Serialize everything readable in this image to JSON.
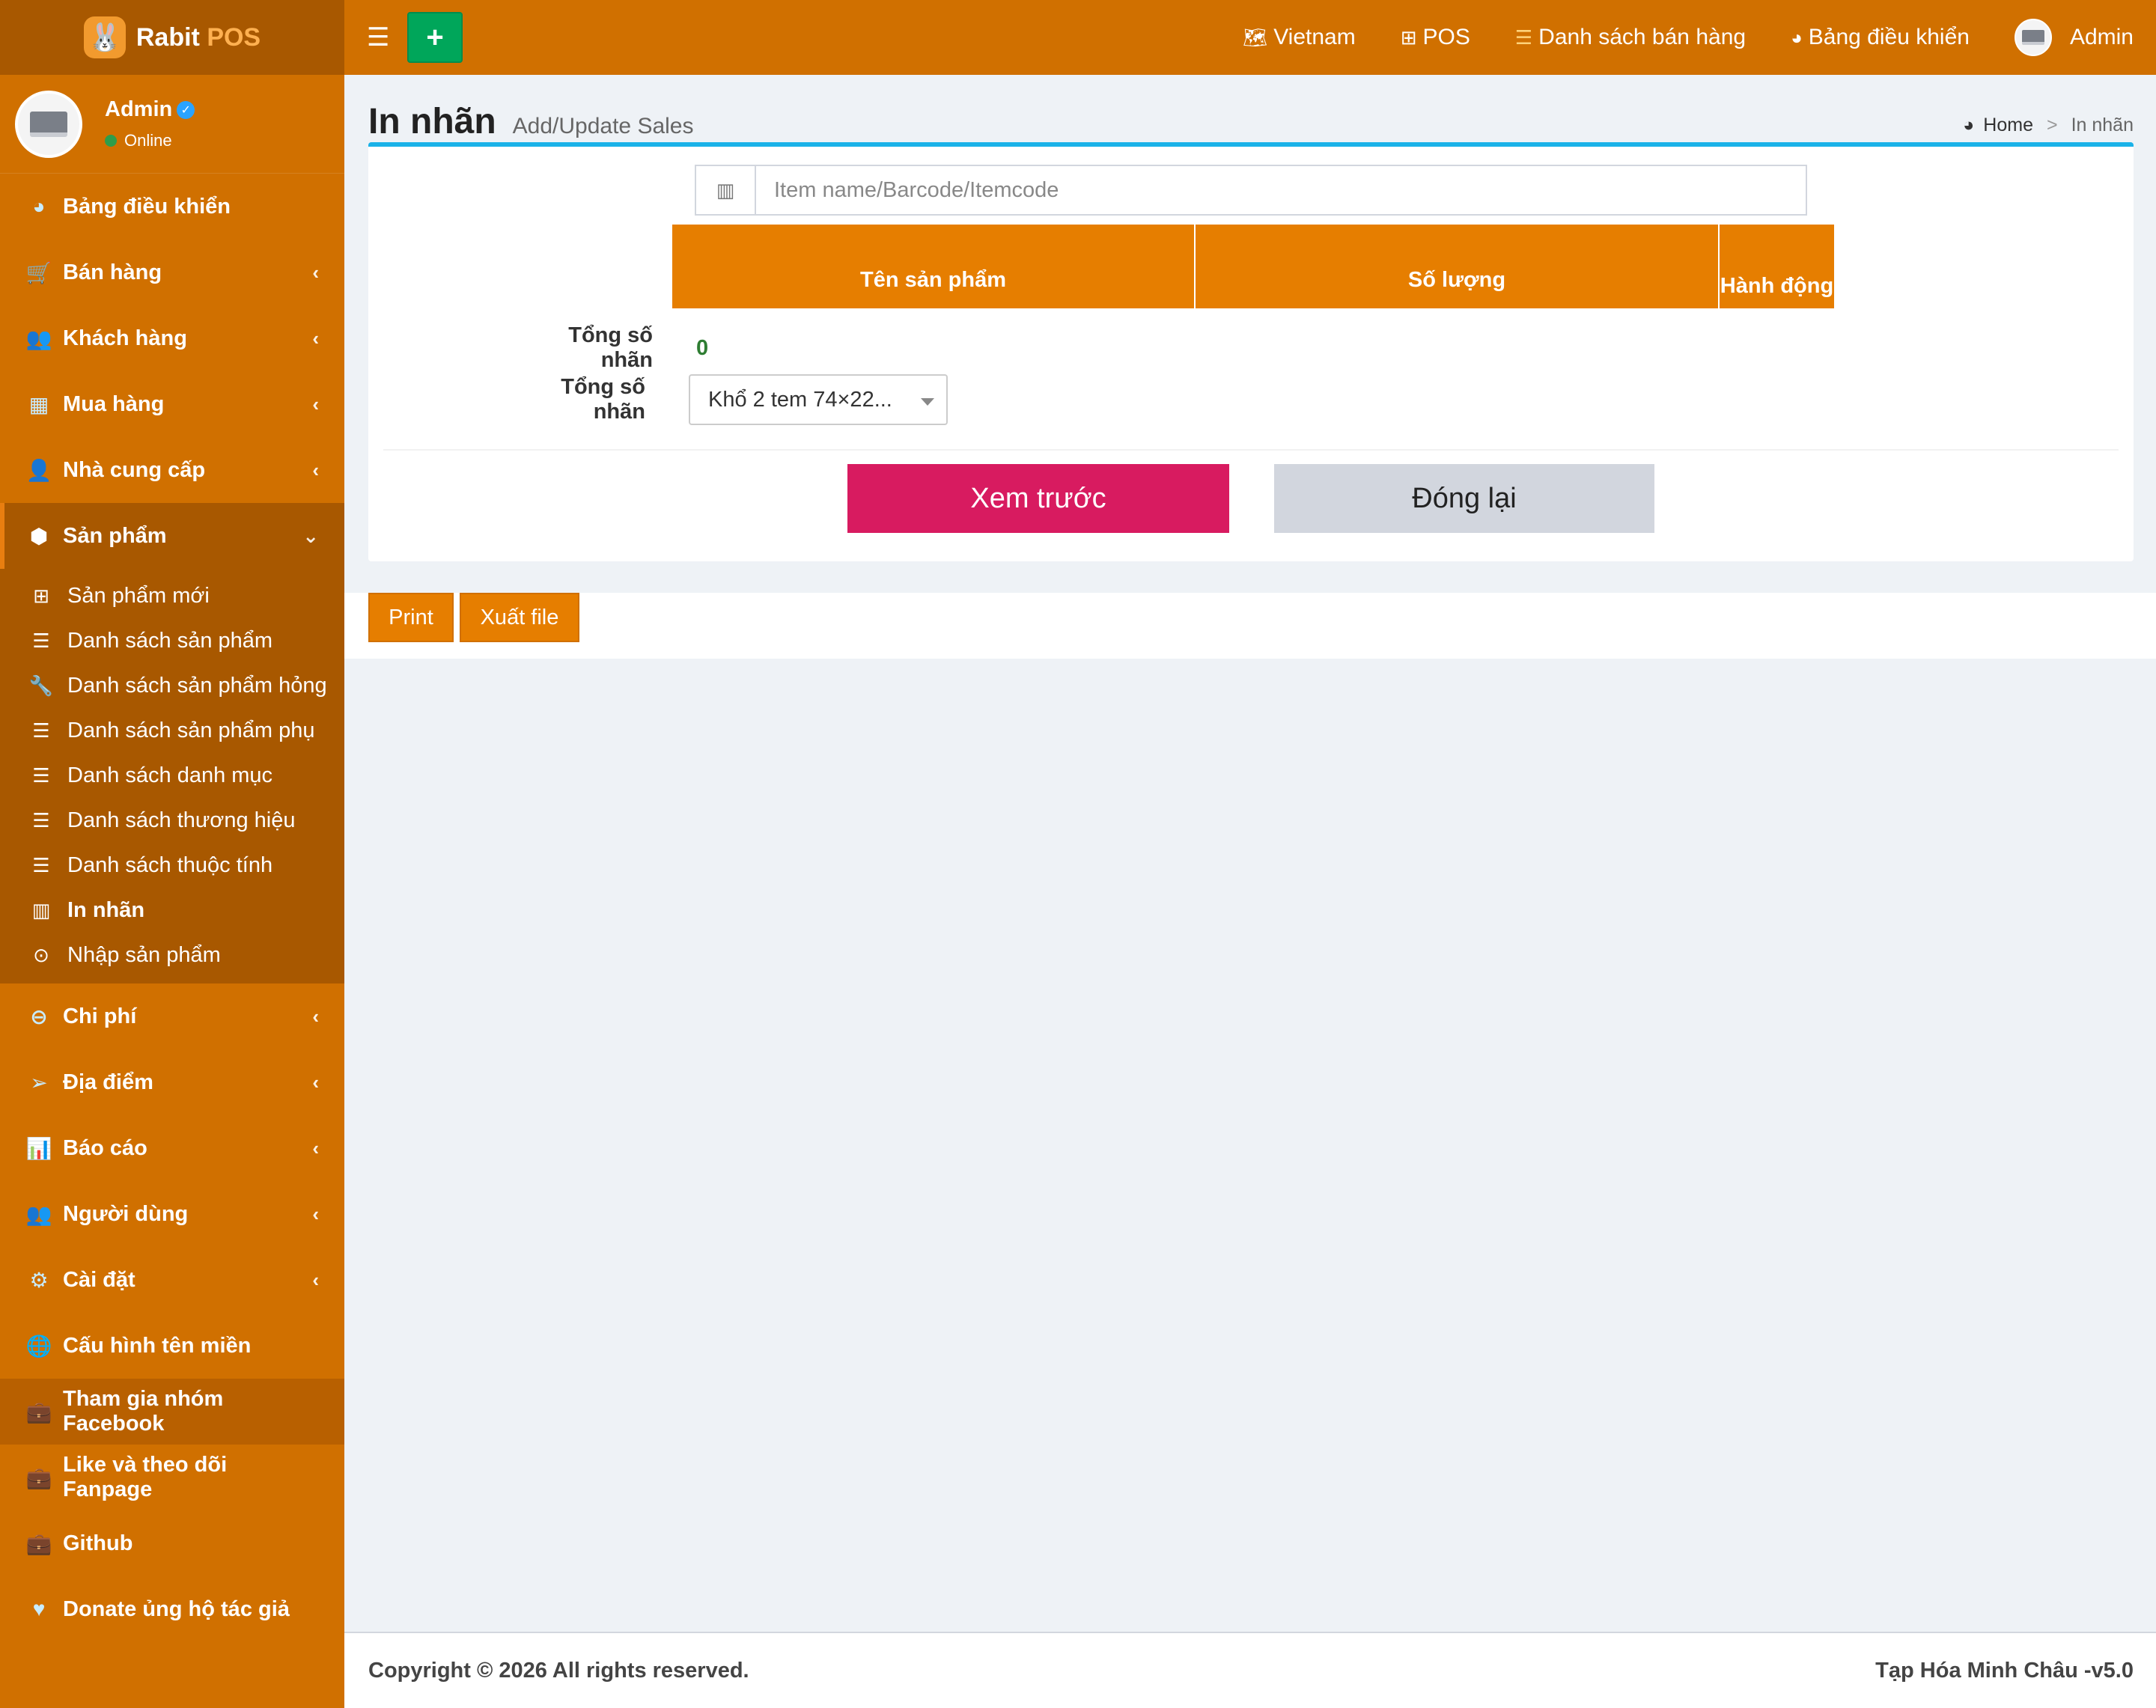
{
  "brand": {
    "name_part1": "Rabit",
    "name_part2": "POS",
    "logo_icon": "rabbit-icon"
  },
  "user": {
    "name": "Admin",
    "status": "Online"
  },
  "sidebar": {
    "items_top": [
      {
        "label": "Bảng điều khiển",
        "icon": "dashboard-icon",
        "has_chevron": false
      },
      {
        "label": "Bán hàng",
        "icon": "cart-icon",
        "has_chevron": true
      },
      {
        "label": "Khách hàng",
        "icon": "users-icon",
        "has_chevron": true
      },
      {
        "label": "Mua hàng",
        "icon": "grid-icon",
        "has_chevron": true
      },
      {
        "label": "Nhà cung cấp",
        "icon": "user-plus-icon",
        "has_chevron": true
      }
    ],
    "open_group": {
      "label": "Sản phẩm",
      "icon": "cubes-icon",
      "children": [
        {
          "label": "Sản phẩm mới",
          "icon": "plus-square-icon"
        },
        {
          "label": "Danh sách sản phẩm",
          "icon": "list-icon"
        },
        {
          "label": "Danh sách sản phẩm hỏng",
          "icon": "wrench-icon"
        },
        {
          "label": "Danh sách sản phẩm phụ",
          "icon": "list-icon"
        },
        {
          "label": "Danh sách danh mục",
          "icon": "list-icon"
        },
        {
          "label": "Danh sách thương hiệu",
          "icon": "list-icon"
        },
        {
          "label": "Danh sách thuộc tính",
          "icon": "list-icon"
        },
        {
          "label": "In nhãn",
          "icon": "barcode-icon",
          "active": true
        },
        {
          "label": "Nhập sản phẩm",
          "icon": "arrow-circle-icon"
        }
      ]
    },
    "items_bottom": [
      {
        "label": "Chi phí",
        "icon": "minus-circle-icon",
        "has_chevron": true
      },
      {
        "label": "Địa điểm",
        "icon": "paper-plane-icon",
        "has_chevron": true
      },
      {
        "label": "Báo cáo",
        "icon": "bar-chart-icon",
        "has_chevron": true
      },
      {
        "label": "Người dùng",
        "icon": "users-icon",
        "has_chevron": true
      },
      {
        "label": "Cài đặt",
        "icon": "cogs-icon",
        "has_chevron": true
      },
      {
        "label": "Cấu hình tên miền",
        "icon": "globe-icon",
        "has_chevron": false
      },
      {
        "label": "Tham gia nhóm Facebook",
        "icon": "briefcase-icon",
        "has_chevron": false,
        "highlight": true
      },
      {
        "label": "Like và theo dõi Fanpage",
        "icon": "briefcase-icon",
        "has_chevron": false
      },
      {
        "label": "Github",
        "icon": "briefcase-icon",
        "has_chevron": false
      },
      {
        "label": "Donate ủng hộ tác giả",
        "icon": "heart-icon",
        "has_chevron": false
      }
    ]
  },
  "topbar": {
    "language": "Vietnam",
    "pos": "POS",
    "sales_list": "Danh sách bán hàng",
    "dashboard": "Bảng điều khiển",
    "user": "Admin"
  },
  "page": {
    "title": "In nhãn",
    "subtitle": "Add/Update Sales",
    "breadcrumb": {
      "home": "Home",
      "current": "In nhãn"
    }
  },
  "form": {
    "search_placeholder": "Item name/Barcode/Itemcode",
    "table_headers": [
      "Tên sản phẩm",
      "Số lượng",
      "Hành động"
    ],
    "total_label": "Tổng số nhãn",
    "total_value": "0",
    "size_label": "Tổng số nhãn",
    "size_selected": "Khổ 2 tem 74×22...",
    "preview_button": "Xem trước",
    "close_button": "Đóng lại"
  },
  "actions": {
    "print": "Print",
    "export": "Xuất file"
  },
  "footer": {
    "copyright": "Copyright © 2026 All rights reserved.",
    "version": "Tạp Hóa Minh Châu -v5.0"
  },
  "colors": {
    "primary": "#d07000",
    "header_orange": "#e67e00",
    "accent_pink": "#d81b60",
    "info_blue": "#1ab2e8",
    "success_green": "#00a65a"
  }
}
